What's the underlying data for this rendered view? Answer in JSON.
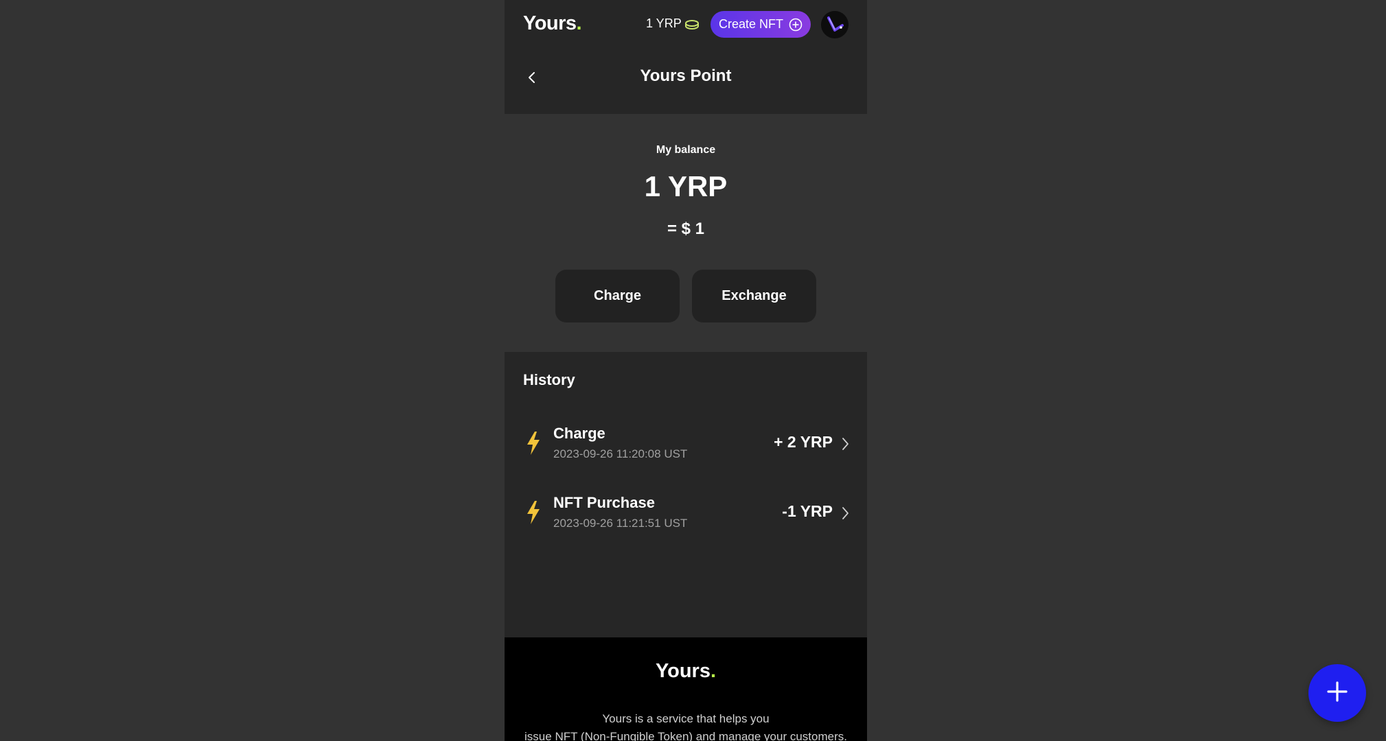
{
  "header": {
    "logo": "Yours",
    "logo_dot": ".",
    "points_balance": "1 YRP",
    "create_button_label": "Create NFT",
    "accent_color": "#6b3ce6",
    "logo_dot_color": "#b7f04a"
  },
  "page": {
    "title": "Yours Point"
  },
  "balance": {
    "label": "My balance",
    "value": "1 YRP",
    "usd": "= $ 1"
  },
  "actions": {
    "charge_label": "Charge",
    "exchange_label": "Exchange"
  },
  "history": {
    "title": "History",
    "items": [
      {
        "icon": "bolt-icon",
        "title": "Charge",
        "date": "2023-09-26 11:20:08 UST",
        "amount": "+ 2 YRP"
      },
      {
        "icon": "bolt-icon",
        "title": "NFT Purchase",
        "date": "2023-09-26 11:21:51 UST",
        "amount": "-1 YRP"
      }
    ]
  },
  "footer": {
    "logo": "Yours",
    "logo_dot": ".",
    "line1": "Yours is a service that helps you",
    "line2": "issue NFT (Non-Fungible Token) and manage your customers."
  },
  "fab": {
    "icon": "plus-icon",
    "color": "#1f1ff0"
  }
}
